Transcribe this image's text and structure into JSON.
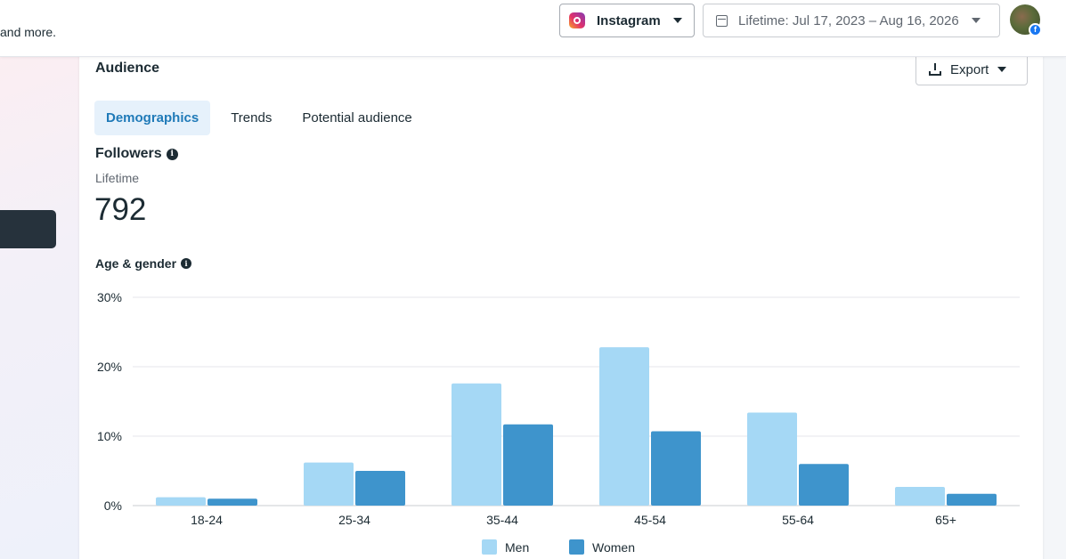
{
  "topbar": {
    "description_tail": "and more.",
    "platform_label": "Instagram",
    "date_range_label": "Lifetime: Jul 17, 2023 – Aug 16, 2026",
    "fb_badge": "f"
  },
  "card": {
    "title": "Audience",
    "export_label": "Export",
    "tabs": [
      {
        "label": "Demographics",
        "active": true
      },
      {
        "label": "Trends",
        "active": false
      },
      {
        "label": "Potential audience",
        "active": false
      }
    ],
    "followers_label": "Followers",
    "period_label": "Lifetime",
    "followers_count": "792",
    "chart_section_label": "Age & gender",
    "info_glyph": "i"
  },
  "colors": {
    "men": "#a5d8f5",
    "women": "#3e94cc",
    "active_tab_bg": "#e6f1fb",
    "active_tab_text": "#1f7ab8"
  },
  "chart_data": {
    "type": "bar",
    "categories": [
      "18-24",
      "25-34",
      "35-44",
      "45-54",
      "55-64",
      "65+"
    ],
    "series": [
      {
        "name": "Men",
        "values": [
          1.2,
          6.2,
          17.6,
          22.8,
          13.4,
          2.7
        ]
      },
      {
        "name": "Women",
        "values": [
          1.0,
          5.0,
          11.7,
          10.7,
          6.0,
          1.7
        ]
      }
    ],
    "ylim": [
      0,
      30
    ],
    "yticks": [
      "0%",
      "10%",
      "20%",
      "30%"
    ],
    "ytick_values": [
      0,
      10,
      20,
      30
    ],
    "grid": true,
    "legend_position": "bottom-center"
  }
}
